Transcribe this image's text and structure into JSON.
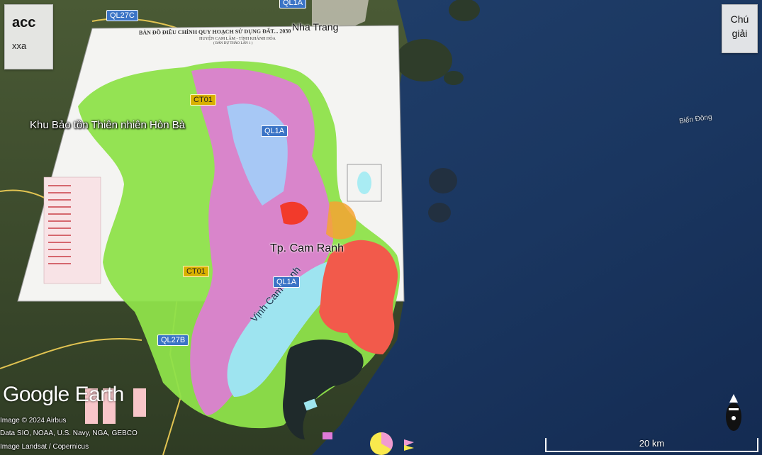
{
  "panel_acc": {
    "title": "acc",
    "subtitle": "xxa"
  },
  "legend_button": {
    "line1": "Chú",
    "line2": "giải"
  },
  "places": {
    "khu_bao_ton": "Khu Bảo tồn Thiên nhiên Hòn Bà",
    "tp_cam_ranh": "Tp. Cam Ranh",
    "nha_trang": "Nha Trang",
    "bien_dong": "Biển Đông",
    "vinh_cam_ranh": "Vịnh Cam Ranh"
  },
  "roads": {
    "ql27c": "QL27C",
    "ql1a_top": "QL1A",
    "ct01_top": "CT01",
    "ql1a_mid": "QL1A",
    "ct01_mid": "CT01",
    "ql1a_low": "QL1A",
    "ql27b": "QL27B"
  },
  "overlay_doc": {
    "title": "BẢN ĐỒ ĐIỀU CHỈNH QUY HOẠCH SỬ DỤNG ĐẤT... 2030",
    "subtitle": "HUYỆN CAM LÂM - TỈNH KHÁNH HÒA",
    "note": "( BẢN DỰ THẢO LẦN 1 )"
  },
  "branding": {
    "logo": "Google Earth"
  },
  "credits": [
    "Image © 2024 Airbus",
    "Data SIO, NOAA, U.S. Navy, NGA, GEBCO",
    "Image Landsat / Copernicus"
  ],
  "scale": {
    "label": "20 km"
  },
  "colors": {
    "sea": "#1b3a66",
    "land": "#3b4a2a",
    "green_zone": "#8ee24a",
    "pink_zone": "#e07ad8",
    "red_zone": "#f25a4b",
    "bay_water": "#9ee4f0",
    "road_shield": "#3b74c6"
  }
}
